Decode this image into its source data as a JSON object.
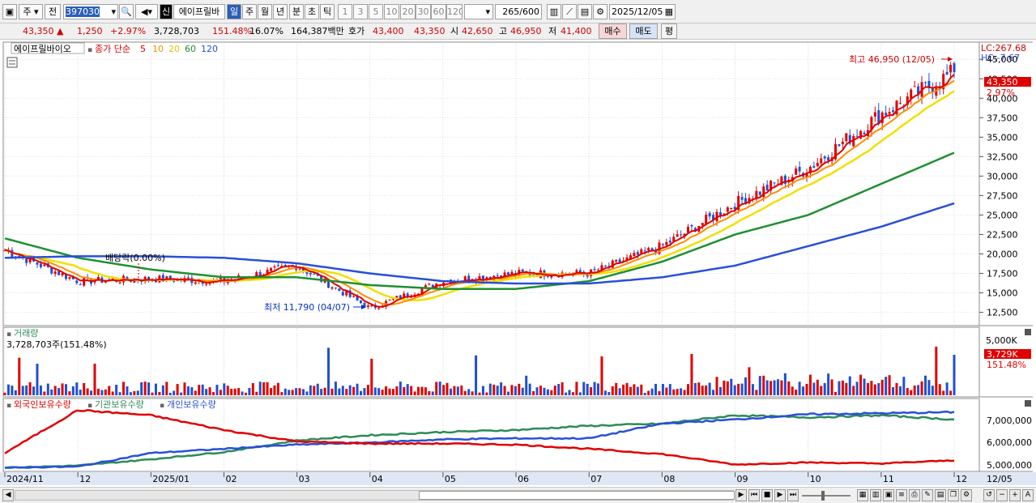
{
  "toolbar": {
    "period_menu": "주",
    "prev_label": "전",
    "code": "397030",
    "stock_name": "에이프릴바",
    "sin_badge": "신",
    "tabs": [
      "일",
      "주",
      "월",
      "년",
      "분",
      "초",
      "틱"
    ],
    "active_tab": "일",
    "intervals": [
      "1",
      "3",
      "5",
      "10",
      "20",
      "30",
      "60",
      "120"
    ],
    "count": "265",
    "count_max": "/600",
    "date": "2025/12/05"
  },
  "quote": {
    "price": "43,350",
    "arrow": "▲",
    "change": "1,250",
    "change_pct": "+2.97%",
    "volume": "3,728,703",
    "vol_ratio": "151.48%",
    "turnover": "16.07%",
    "amount": "164,387백만",
    "bid_label": "호가",
    "bid": "43,400",
    "ask": "43,350",
    "open_label": "시",
    "open": "42,650",
    "high_label": "고",
    "high": "46,950",
    "low_label": "저",
    "low": "41,400",
    "buy_btn": "매수",
    "sell_btn": "매도",
    "eval_btn": "평"
  },
  "price_panel": {
    "stock_label": "에이프릴바이오",
    "ma_label": "종가 단순",
    "ma_periods": [
      "5",
      "10",
      "20",
      "60",
      "120"
    ],
    "lc": "LC:267.68",
    "hc": "HC:-7.67",
    "high_note": "최고 46,950 (12/05)",
    "low_note": "최저 11,790 (04/07)",
    "dividend_note": "배당락(0.00%)",
    "current_price_tag": "43,350",
    "current_pct_tag": "2.97%",
    "y_ticks": [
      "45,000",
      "42,500",
      "40,000",
      "37,500",
      "35,000",
      "32,500",
      "30,000",
      "27,500",
      "25,000",
      "22,500",
      "20,000",
      "17,500",
      "15,000",
      "12,500"
    ]
  },
  "volume_panel": {
    "title": "거래량",
    "value": "3,728,703주(151.48%)",
    "y_tick": "5,000K",
    "current_tag": "3,729K",
    "current_pct": "151.48%"
  },
  "holding_panel": {
    "series": [
      "외국인보유수량",
      "기관보유수량",
      "개인보유수량"
    ],
    "y_ticks": [
      "7,000,000",
      "6,000,000",
      "5,000,000"
    ],
    "colors": {
      "foreign": "#e00000",
      "institution": "#2e8b57",
      "individual": "#2850d8"
    }
  },
  "x_axis": {
    "labels": [
      "2024/11",
      "12",
      "2025/01",
      "02",
      "03",
      "04",
      "05",
      "06",
      "07",
      "08",
      "09",
      "10",
      "11",
      "12"
    ],
    "end_label": "12/05"
  },
  "colors": {
    "ma5": "#e00000",
    "ma10": "#ff8c00",
    "ma20": "#f0e000",
    "ma60": "#1e9030",
    "ma120": "#2850d8",
    "up": "#e00000",
    "down": "#2050d0"
  },
  "chart_data": {
    "type": "candlestick",
    "x": [
      "2024/11",
      "2024/12",
      "2025/01",
      "2025/02",
      "2025/03",
      "2025/04",
      "2025/05",
      "2025/06",
      "2025/07",
      "2025/08",
      "2025/09",
      "2025/10",
      "2025/11",
      "2025/12"
    ],
    "series": [
      {
        "name": "종가",
        "values": [
          20500,
          16500,
          16800,
          16500,
          18500,
          13000,
          16500,
          17500,
          17500,
          21000,
          26500,
          31000,
          38000,
          43350
        ]
      },
      {
        "name": "60",
        "values": [
          22000,
          19500,
          18000,
          17000,
          17000,
          16000,
          15500,
          15500,
          16500,
          19000,
          22500,
          25000,
          29000,
          33000
        ]
      },
      {
        "name": "120",
        "values": [
          19500,
          19700,
          19700,
          19500,
          18800,
          17500,
          16500,
          16200,
          16200,
          17000,
          18500,
          21000,
          23500,
          26500
        ]
      }
    ],
    "ylim": [
      11000,
      47000
    ]
  }
}
